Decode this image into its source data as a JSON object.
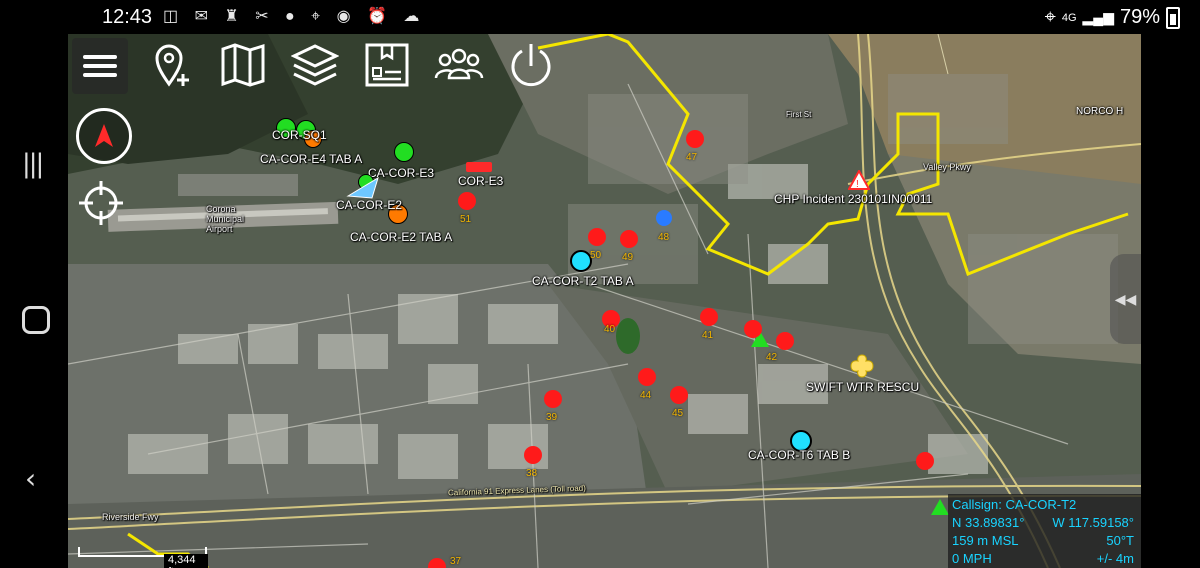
{
  "status_bar": {
    "time": "12:43",
    "icons": "◫ ✉ ♜ ✂ ● ⌖ ◉ ⏰ ☁",
    "network": "4G",
    "battery": "79%"
  },
  "toolbar": {
    "items": [
      "menu-icon",
      "add-point-icon",
      "map-icon",
      "layers-icon",
      "files-icon",
      "contacts-icon",
      "power-icon"
    ]
  },
  "compass_icon": "north-arrow-icon",
  "locate_icon": "crosshair-icon",
  "markers": {
    "cor_sq1": "COR-SQ1",
    "ca_cor_e4_tab_a": "CA-COR-E4 TAB A",
    "ca_cor_e3": "CA-COR-E3",
    "cor_e3": "COR-E3",
    "ca_cor_e2": "CA-COR-E2",
    "ca_cor_e2_tab_a": "CA-COR-E2 TAB A",
    "ca_cor_t2_tab_a": "CA-COR-T2 TAB A",
    "chp_incident": "CHP Incident 230101IN00011",
    "swift_wtr_rescu": "SWIFT WTR RESCU",
    "ca_cor_t6_tab_b": "CA-COR-T6 TAB B"
  },
  "point_numbers": {
    "n47": "47",
    "n51": "51",
    "n48": "48",
    "n49": "49",
    "n50": "50",
    "n40": "40",
    "n41": "41",
    "n42": "42",
    "n39": "39",
    "n44": "44",
    "n45": "45",
    "n38": "38",
    "n37": "37"
  },
  "map_labels": {
    "airport": "Corona Municipal Airport",
    "norco": "NORCO H",
    "freeway": "California 91 Express Lanes (Toll road)",
    "valley_pkwy": "Valley Pkwy",
    "first_st": "First St",
    "riverside_fwy": "Riverside Fwy"
  },
  "info_panel": {
    "callsign": "Callsign: CA-COR-T2",
    "lat": "N 33.89831°",
    "lon": "W 117.59158°",
    "altitude": "159 m MSL",
    "heading": "50°T",
    "speed": "0 MPH",
    "accuracy": "+/- 4m"
  },
  "scale_bar": "4,344 ft",
  "colors": {
    "hostile_red": "#ff1a1a",
    "friendly_cyan": "#20e0ff",
    "neutral_green": "#22dd22",
    "unknown_yellow": "#ffe066",
    "boundary_yellow": "#f4e600",
    "info_text": "#19d3ff"
  }
}
